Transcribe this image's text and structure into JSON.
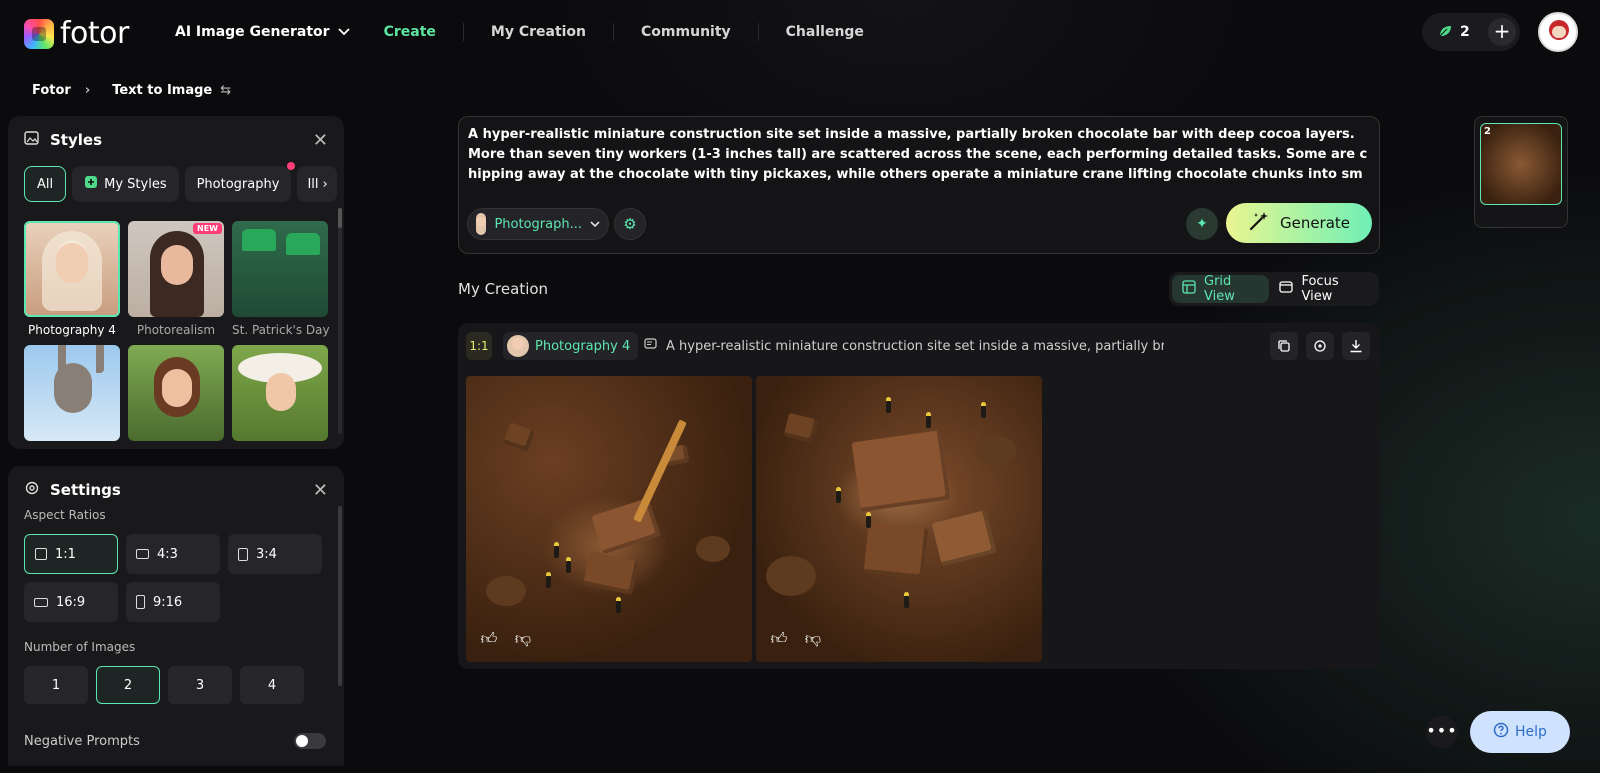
{
  "header": {
    "brand": "fotor",
    "nav_dropdown": "AI Image Generator",
    "nav": [
      "Create",
      "My Creation",
      "Community",
      "Challenge"
    ],
    "credits": "2"
  },
  "breadcrumb": {
    "root": "Fotor",
    "current": "Text to Image"
  },
  "styles_panel": {
    "title": "Styles",
    "chips": [
      "All",
      "My Styles",
      "Photography",
      "Ill"
    ],
    "items": [
      {
        "label": "Photography 4",
        "selected": true
      },
      {
        "label": "Photorealism",
        "badge": "NEW"
      },
      {
        "label": "St. Patrick's Day"
      },
      {
        "label": ""
      },
      {
        "label": ""
      },
      {
        "label": ""
      }
    ]
  },
  "settings_panel": {
    "title": "Settings",
    "aspect_label": "Aspect Ratios",
    "ratios": [
      "1:1",
      "4:3",
      "3:4",
      "16:9",
      "9:16"
    ],
    "ratio_selected": "1:1",
    "num_label": "Number of Images",
    "nums": [
      "1",
      "2",
      "3",
      "4"
    ],
    "num_selected": "2",
    "negative_label": "Negative Prompts"
  },
  "prompt": {
    "text": "A hyper-realistic miniature construction site set inside a massive, partially broken chocolate bar with deep cocoa layers. More than seven tiny workers (1-3 inches tall) are scattered across the scene, each performing detailed tasks. Some are chipping away at the chocolate with tiny pickaxes, while others operate a miniature crane lifting chocolate chunks into small wheelbarrows. ...",
    "style_pill": "Photograph...",
    "generate_label": "Generate"
  },
  "creation": {
    "title": "My Creation",
    "grid_view": "Grid View",
    "focus_view": "Focus View",
    "ratio": "1:1",
    "style": "Photography 4",
    "prompt_summary": "A hyper-realistic miniature construction site set inside a massive, partially br..."
  },
  "history": {
    "count": "2"
  },
  "help": {
    "label": "Help"
  },
  "colors": {
    "accent": "#5ee6b0",
    "background": "#0b0b0d",
    "panel": "#19191c"
  }
}
